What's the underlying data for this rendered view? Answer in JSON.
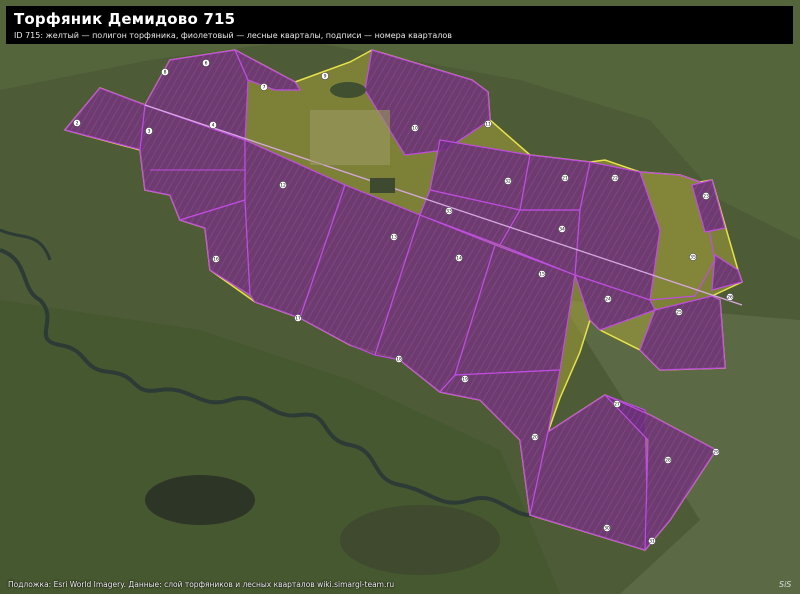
{
  "header": {
    "title": "Торфяник Демидово 715",
    "subtitle": "ID 715: желтый — полигон торфяника, фиолетовый — лесные кварталы, подписи — номера кварталов"
  },
  "footer": {
    "attribution": "Подложка: Esri World Imagery. Данные: слой торфяников и лесных кварталов wiki.simargl-team.ru",
    "logo": "SiS"
  },
  "colors": {
    "peat_polygon": "#e8e24a",
    "forest_quarters": "#c04de0",
    "quarter_fill": "#6a2e78",
    "terrain": "#4b5a35",
    "river": "#2f3f3a"
  },
  "quarter_labels": [
    "6",
    "8",
    "7",
    "2",
    "3",
    "4",
    "9",
    "10",
    "11",
    "12",
    "13",
    "14",
    "15",
    "16",
    "17",
    "18",
    "19",
    "20",
    "21",
    "22",
    "23",
    "24",
    "25",
    "26",
    "27",
    "28",
    "29",
    "30",
    "31",
    "32",
    "33",
    "34",
    "35"
  ]
}
